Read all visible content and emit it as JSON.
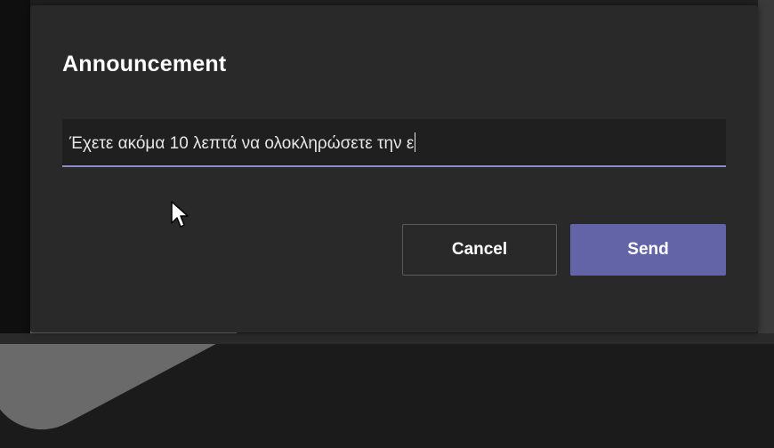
{
  "dialog": {
    "title": "Announcement",
    "message_value": "Έχετε ακόμα 10 λεπτά να ολοκληρώσετε την ε",
    "buttons": {
      "cancel": "Cancel",
      "send": "Send"
    }
  },
  "colors": {
    "dialog_background": "#292929",
    "input_background": "#1f1f1f",
    "input_underline": "#8b8cc7",
    "primary_button": "#6264a7",
    "text": "#ffffff"
  },
  "icons": {
    "cursor": "mouse-pointer-icon"
  }
}
